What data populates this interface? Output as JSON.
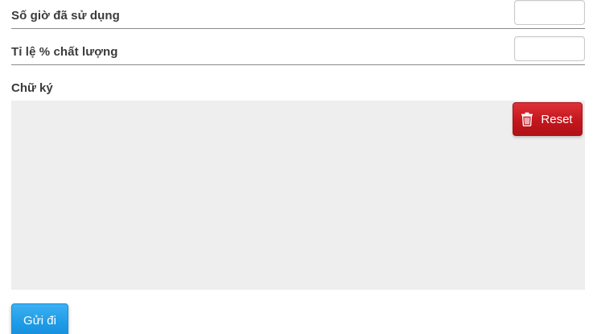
{
  "form": {
    "hours_used": {
      "label": "Số giờ đã sử dụng",
      "value": "",
      "placeholder": ""
    },
    "quality_percent": {
      "label": "Tỉ lệ % chất lượng",
      "value": "",
      "placeholder": ""
    },
    "signature": {
      "label": "Chữ ký",
      "reset_label": "Reset",
      "reset_icon": "trash-icon"
    },
    "submit_label": "Gửi đi"
  },
  "colors": {
    "signature_pad_bg": "#eeeeee",
    "reset_button": "#c4161d",
    "submit_button": "#1e9be6",
    "divider": "#8a8a8a"
  }
}
